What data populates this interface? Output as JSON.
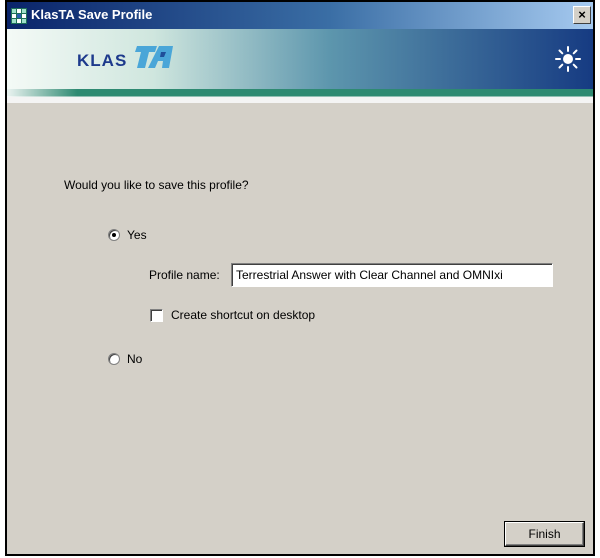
{
  "window": {
    "title": "KlasTA Save Profile",
    "close_label": "×"
  },
  "banner": {
    "logo_text": "KLAS",
    "logo_suffix": "TA"
  },
  "form": {
    "question": "Would you like to save this profile?",
    "yes_label": "Yes",
    "yes_selected": true,
    "profile_name_label": "Profile name:",
    "profile_name_value": "Terrestrial Answer with Clear Channel and OMNIxi",
    "shortcut_label": "Create shortcut on desktop",
    "shortcut_checked": false,
    "no_label": "No",
    "no_selected": false
  },
  "buttons": {
    "finish_label": "Finish"
  },
  "colors": {
    "titlebar_start": "#0a246a",
    "dialog_bg": "#d4d0c8",
    "stripe": "#2e8a72",
    "logo": "#1d3a8c"
  },
  "icons": {
    "app": "grid-app-icon",
    "banner": "sun-icon"
  }
}
